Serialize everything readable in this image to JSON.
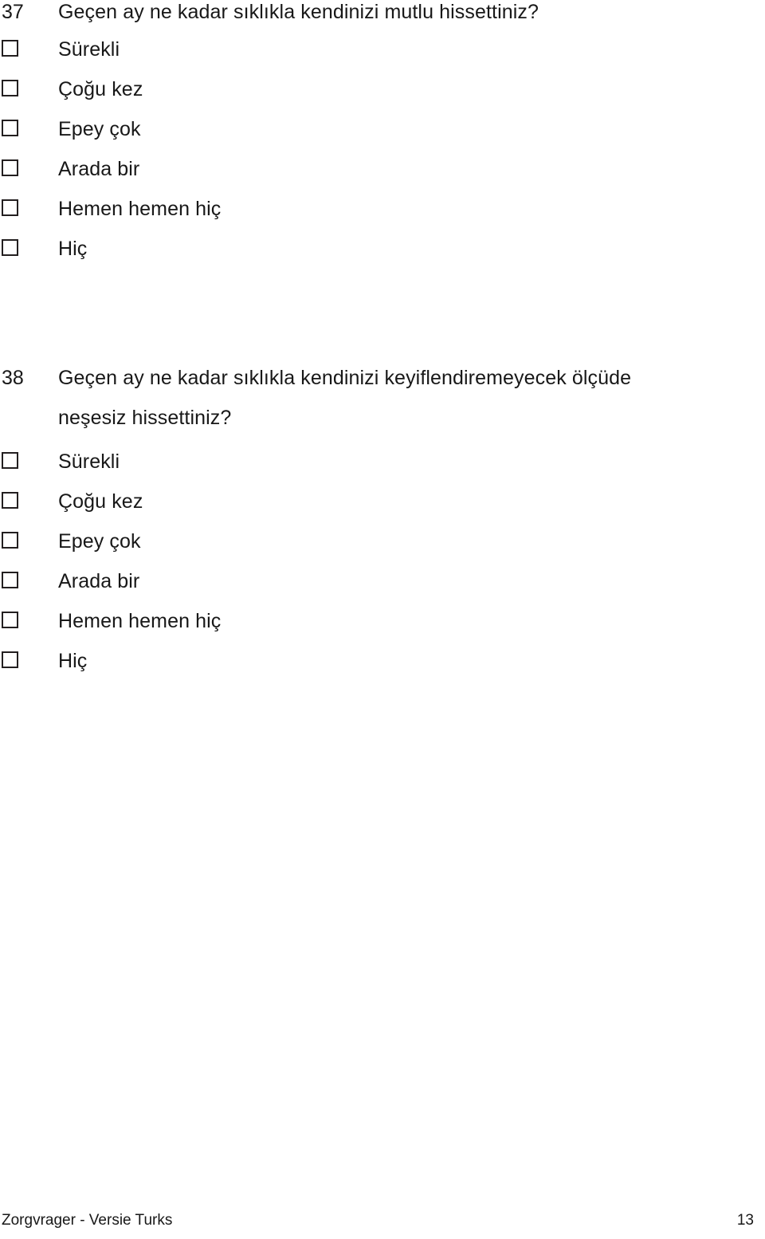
{
  "document": {
    "language": "Turkish",
    "questions": [
      {
        "number": "37",
        "text": "Geçen ay ne kadar sıklıkla kendinizi mutlu hissettiniz?",
        "options": [
          {
            "label": "Sürekli"
          },
          {
            "label": "Çoğu kez"
          },
          {
            "label": "Epey çok"
          },
          {
            "label": "Arada bir"
          },
          {
            "label": "Hemen hemen hiç"
          },
          {
            "label": "Hiç"
          }
        ]
      },
      {
        "number": "38",
        "text": "Geçen ay ne kadar sıklıkla kendinizi keyiflendiremeyecek ölçüde neşesiz hissettiniz?",
        "options": [
          {
            "label": "Sürekli"
          },
          {
            "label": "Çoğu kez"
          },
          {
            "label": "Epey çok"
          },
          {
            "label": "Arada bir"
          },
          {
            "label": "Hemen hemen hiç"
          },
          {
            "label": "Hiç"
          }
        ]
      }
    ]
  },
  "footer": {
    "left_text": "Zorgvrager - Versie Turks",
    "page_number": "13"
  }
}
